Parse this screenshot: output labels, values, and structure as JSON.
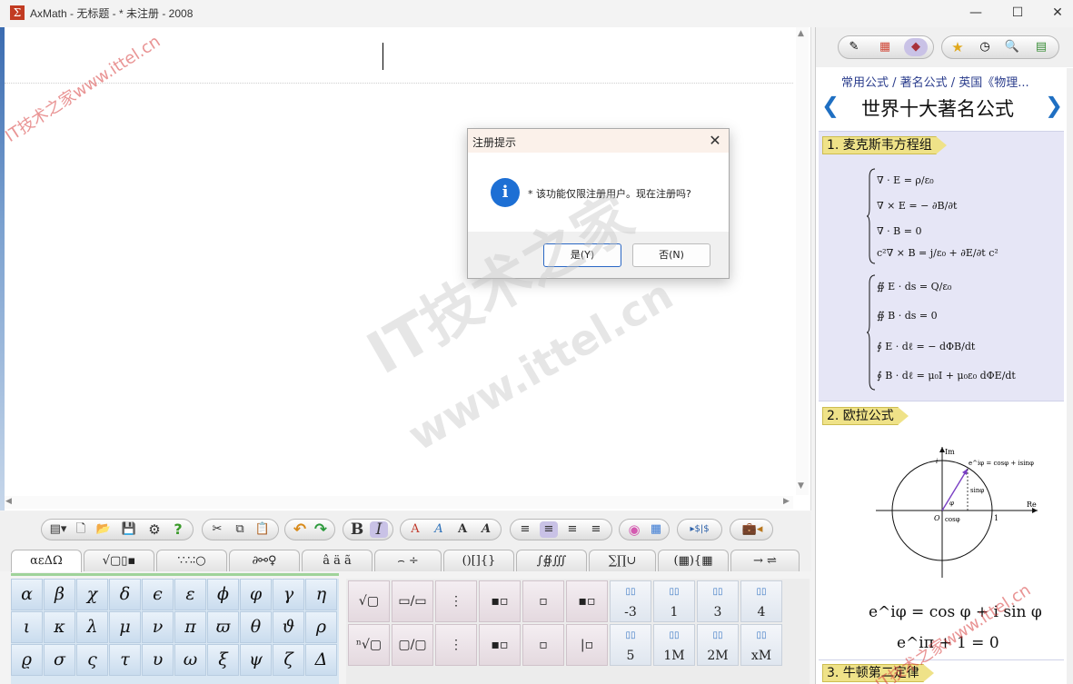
{
  "window": {
    "title": "AxMath - 无标题 - * 未注册 - 2008",
    "min": "—",
    "max": "☐",
    "close": "✕"
  },
  "dialog": {
    "title": "注册提示",
    "message": "* 该功能仅限注册用户。现在注册吗?",
    "yes": "是(Y)",
    "no": "否(N)",
    "close": "✕"
  },
  "toolbar": {
    "menu": "▤▾",
    "new": "🗋",
    "open": "📂",
    "save": "💾",
    "settings": "⚙",
    "help": "?",
    "cut": "✂",
    "copy": "⧉",
    "paste": "📋",
    "undo": "↶",
    "redo": "↷",
    "bold": "B",
    "italic": "I",
    "font1": "A",
    "font2": "A",
    "font3": "A",
    "font4": "A",
    "align_left": "≡",
    "align_center": "≡",
    "align_right": "≡",
    "align_justify": "≡",
    "color": "◉",
    "palette": "▦",
    "dollar": "▸$|$",
    "case": "💼◂"
  },
  "symbol_tabs": [
    "αεΔΩ",
    "√▢▯▪",
    "∵∴∶○",
    "∂⚯♀",
    "â ä ã",
    "⌢ ÷",
    "()[]{}",
    "∫∯∭",
    "∑∏∪",
    "(▦){▦",
    "→ ⇌"
  ],
  "greek": [
    "α",
    "β",
    "χ",
    "δ",
    "ϵ",
    "ε",
    "ϕ",
    "φ",
    "γ",
    "η",
    "ι",
    "κ",
    "λ",
    "μ",
    "ν",
    "π",
    "ϖ",
    "θ",
    "ϑ",
    "ρ",
    "ϱ",
    "σ",
    "ς",
    "τ",
    "υ",
    "ω",
    "ξ",
    "ψ",
    "ζ",
    "Δ"
  ],
  "templates": {
    "row1": [
      "√▢",
      "▭/▭",
      "⋮",
      "▪▫",
      "▫",
      "▪▫",
      "-3",
      "1",
      "3",
      "4"
    ],
    "row2": [
      "ⁿ√▢",
      "▢/▢",
      "⋮",
      "▪▫",
      "▫",
      "|▫",
      "5",
      "1M",
      "2M",
      "xM"
    ]
  },
  "right_panel": {
    "breadcrumb": "常用公式 / 著名公式 / 英国《物理...",
    "prev": "❮",
    "next": "❯",
    "title": "世界十大著名公式",
    "sections": [
      {
        "label": "1. 麦克斯韦方程组"
      },
      {
        "label": "2. 欧拉公式"
      },
      {
        "label": "3. 牛顿第二定律"
      }
    ],
    "maxwell_diff": [
      "∇ · E = ρ/ε₀",
      "∇ × E = − ∂B/∂t",
      "∇ · B = 0",
      "c²∇ × B = j/ε₀ + ∂E/∂t c²"
    ],
    "maxwell_int": [
      "∯ E · ds = Q/ε₀",
      "∯ B · ds = 0",
      "∮ E · dℓ = − dΦB/dt",
      "∮ B · dℓ = μ₀I + μ₀ε₀ dΦE/dt"
    ],
    "euler_diagram": {
      "im": "Im",
      "re": "Re",
      "origin": "O",
      "one": "1",
      "i": "i",
      "point": "e^iφ = cosφ + isinφ",
      "sin": "sinφ",
      "cos": "cosφ",
      "phi": "φ"
    },
    "euler_1": "e^iφ = cos φ + i sin φ",
    "euler_2": "e^iπ + 1 = 0"
  },
  "watermark": {
    "main": "IT技术之家",
    "url": "www.ittel.cn",
    "corner1": "IT技术之家www.ittel.cn",
    "corner2": "IT技术之家www.ittel.cn"
  }
}
